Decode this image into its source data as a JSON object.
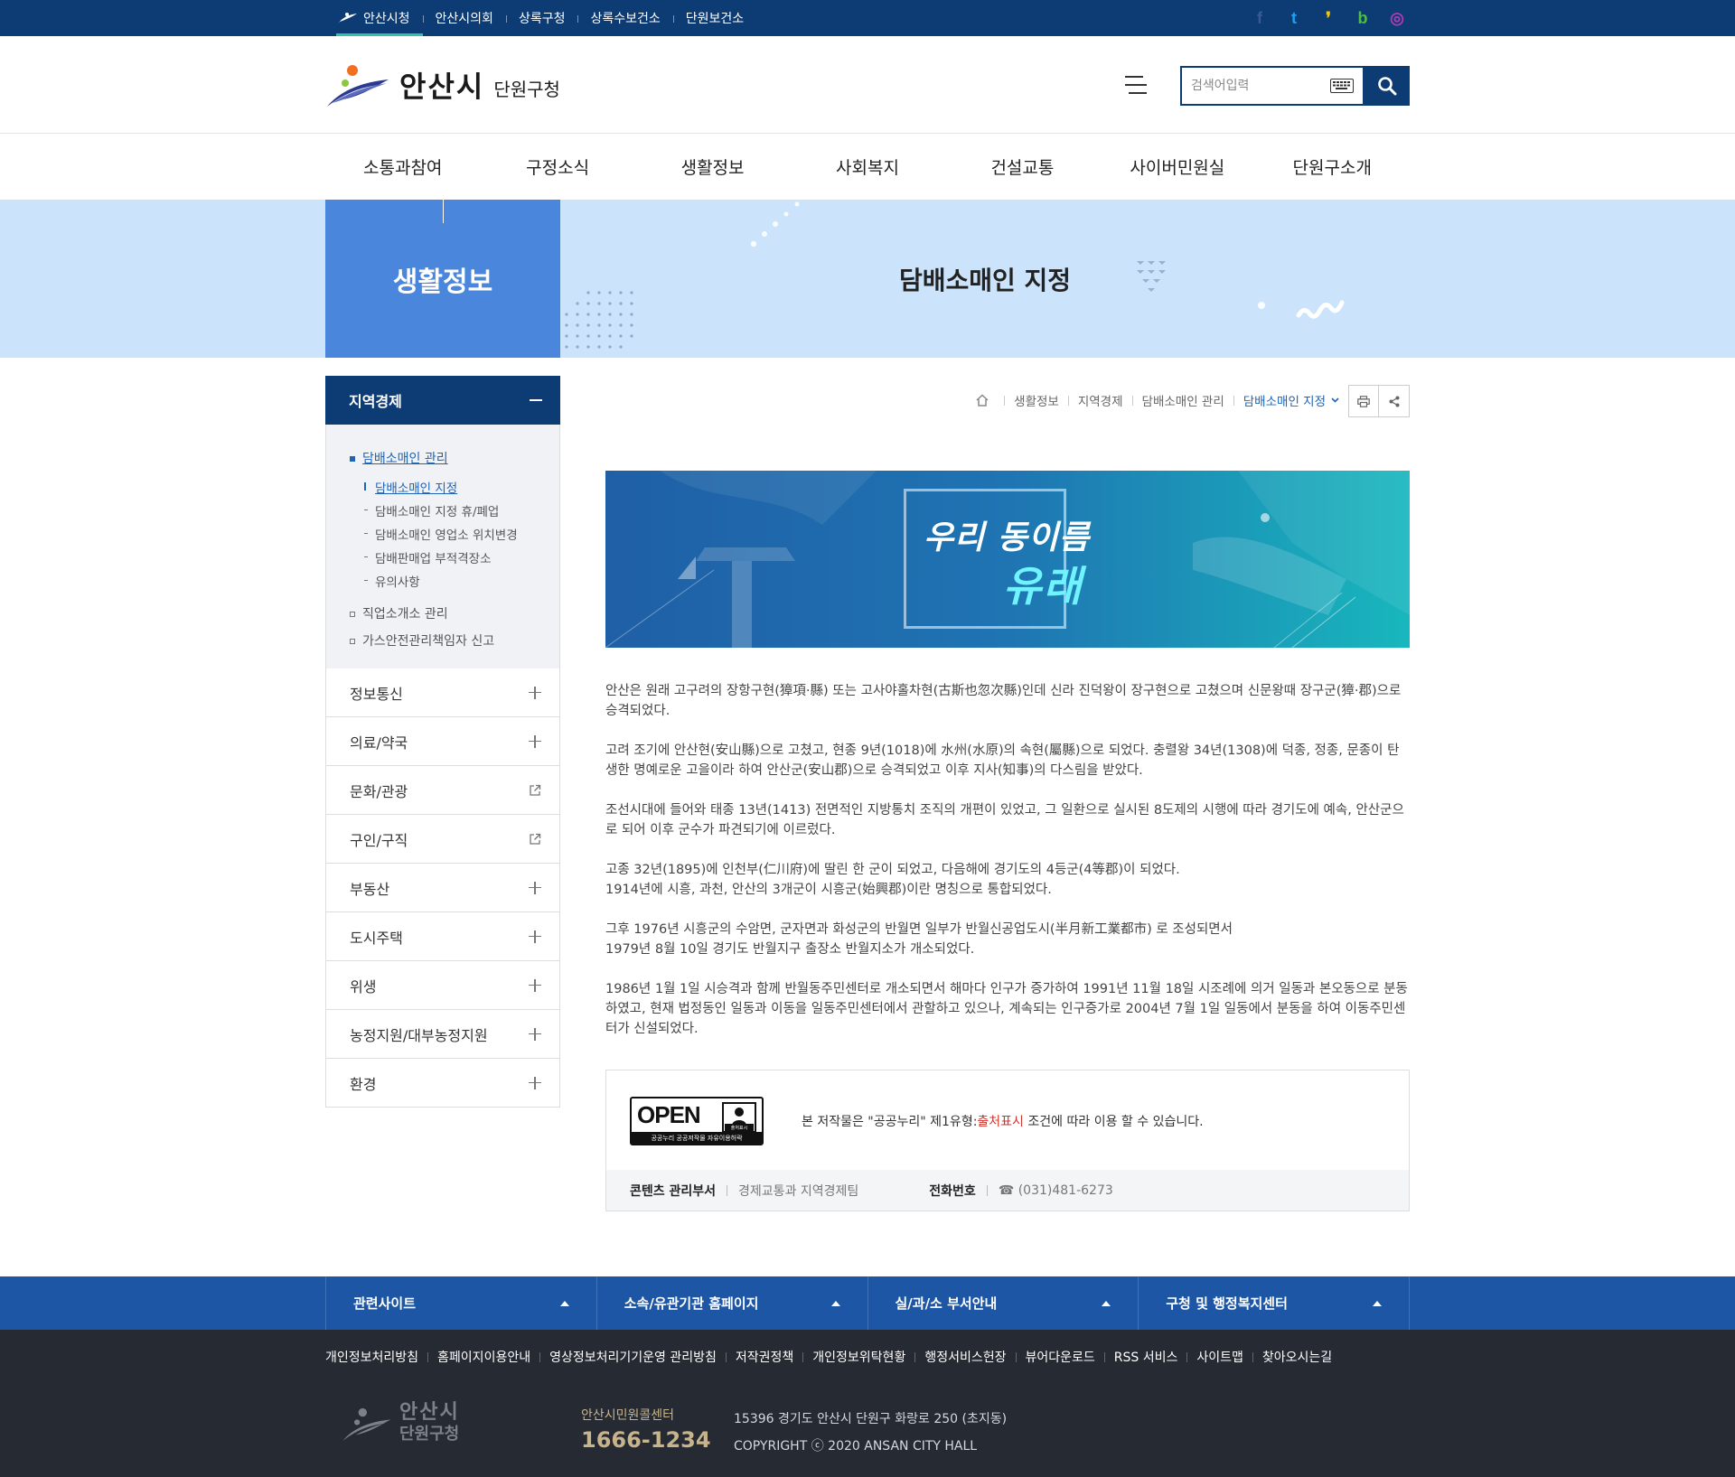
{
  "topbar": {
    "links": [
      {
        "label": "안산시청",
        "active": true
      },
      {
        "label": "안산시의회"
      },
      {
        "label": "상록구청"
      },
      {
        "label": "상록수보건소"
      },
      {
        "label": "단원보건소"
      }
    ],
    "social": [
      {
        "name": "facebook-icon",
        "glyph": "f",
        "color": "#3b5998"
      },
      {
        "name": "twitter-icon",
        "glyph": "t",
        "color": "#1da1f2"
      },
      {
        "name": "kakaostory-icon",
        "glyph": "❜",
        "color": "#f7c600"
      },
      {
        "name": "band-icon",
        "glyph": "b",
        "color": "#4cc03f"
      },
      {
        "name": "instagram-icon",
        "glyph": "◎",
        "color": "#b13ab5"
      }
    ]
  },
  "header": {
    "logo_city": "안산시",
    "logo_gu": "단원구청",
    "search_placeholder": "검색어입력"
  },
  "gnb": [
    "소통과참여",
    "구정소식",
    "생활정보",
    "사회복지",
    "건설교통",
    "사이버민원실",
    "단원구소개"
  ],
  "visual": {
    "category": "생활정보",
    "page_title": "담배소매인 지정"
  },
  "lnb": {
    "head": "지역경제",
    "depth3": [
      {
        "label": "담배소매인 관리",
        "on": true,
        "children": [
          {
            "label": "담배소매인 지정",
            "on": true
          },
          {
            "label": "담배소매인 지정 휴/폐업"
          },
          {
            "label": "담배소매인 영업소 위치변경"
          },
          {
            "label": "담배판매업 부적격장소"
          },
          {
            "label": "유의사항"
          }
        ]
      },
      {
        "label": "직업소개소 관리"
      },
      {
        "label": "가스안전관리책임자 신고"
      }
    ],
    "items": [
      {
        "label": "정보통신",
        "type": "plus"
      },
      {
        "label": "의료/약국",
        "type": "plus"
      },
      {
        "label": "문화/관광",
        "type": "external"
      },
      {
        "label": "구인/구직",
        "type": "external"
      },
      {
        "label": "부동산",
        "type": "plus"
      },
      {
        "label": "도시주택",
        "type": "plus"
      },
      {
        "label": "위생",
        "type": "plus"
      },
      {
        "label": "농정지원/대부농정지원",
        "type": "plus"
      },
      {
        "label": "환경",
        "type": "plus"
      }
    ]
  },
  "breadcrumb": [
    "생활정보",
    "지역경제",
    "담배소매인 관리",
    "담배소매인 지정"
  ],
  "banner": {
    "line1": "우리 동이름",
    "line2": "유래"
  },
  "paragraphs": [
    "안산은 원래 고구려의 장항구현(獐項·縣) 또는 고사야홀차현(古斯也忽次縣)인데 신라 진덕왕이 장구현으로 고쳤으며 신문왕때 장구군(獐·郡)으로 승격되었다.",
    "고려 조기에 안산현(安山縣)으로 고쳤고, 현종 9년(1018)에 水州(水原)의 속현(屬縣)으로 되었다. 충렬왕 34년(1308)에 덕종, 정종, 문종이 탄생한 명예로운 고을이라 하여 안산군(安山郡)으로 승격되었고 이후 지사(知事)의 다스림을 받았다.",
    "조선시대에 들어와 태종 13년(1413) 전면적인 지방통치 조직의 개편이 있었고, 그 일환으로 실시된 8도제의 시행에 따라 경기도에 예속, 안산군으로 되어 이후 군수가 파견되기에 이르렀다.",
    "고종 32년(1895)에 인천부(仁川府)에 딸린 한 군이 되었고, 다음해에 경기도의 4등군(4等郡)이 되었다.\n1914년에 시흥, 과천, 안산의 3개군이 시흥군(始興郡)이란 명칭으로 통합되었다.",
    "그후 1976년 시흥군의 수암면, 군자면과 화성군의 반월면 일부가 반월신공업도시(半月新工業都市) 로 조성되면서\n1979년 8월 10일 경기도 반월지구 출장소 반월지소가 개소되었다.",
    "1986년 1월 1일 시승격과 함께 반월동주민센터로 개소되면서 해마다 인구가 증가하여 1991년 11월 18일 시조례에 의거 일동과 본오동으로 분동하였고, 현재 법정동인 일동과 이동을 일동주민센터에서 관할하고 있으나, 계속되는 인구증가로 2004년 7월 1일 일동에서 분동을 하여 이동주민센터가 신설되었다."
  ],
  "license": {
    "open_word": "OPEN",
    "open_bar": "공공누리  공공저작물 자유이용허락",
    "open_badge": "출처표시",
    "msg_before": "본 저작물은 \"공공누리\" 제1유형:",
    "msg_red": "출처표시",
    "msg_after": " 조건에 따라 이용 할 수 있습니다.",
    "dept_label": "콘텐츠 관리부서",
    "dept_value": "경제교통과 지역경제팀",
    "tel_label": "전화번호",
    "tel_value": "☎ (031)481-6273"
  },
  "footer_nav": [
    "관련사이트",
    "소속/유관기관 홈페이지",
    "실/과/소 부서안내",
    "구청 및 행정복지센터"
  ],
  "footer_links": [
    "개인정보처리방침",
    "홈페이지이용안내",
    "영상정보처리기기운영 관리방침",
    "저작권정책",
    "개인정보위탁현황",
    "행정서비스헌장",
    "뷰어다운로드",
    "RSS 서비스",
    "사이트맵",
    "찾아오시는길"
  ],
  "footer": {
    "logo_city": "안산시",
    "logo_gu": "단원구청",
    "call_label": "안산시민원콜센터",
    "call_number": "1666-1234",
    "address": "15396 경기도 안산시 단원구 화랑로 250 (초지동)",
    "copyright": "COPYRIGHT ⓒ 2020 ANSAN CITY HALL"
  }
}
